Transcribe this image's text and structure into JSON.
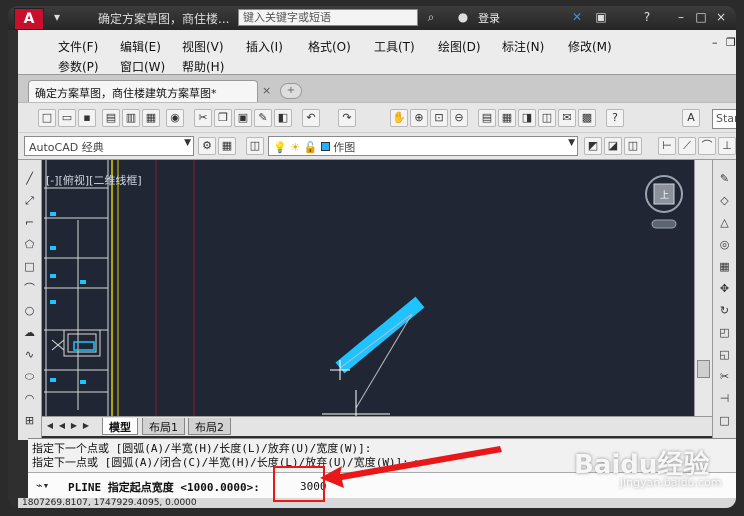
{
  "titlebar": {
    "logo": "A",
    "title": "确定方案草图，商住楼...",
    "search_placeholder": "键入关键字或短语",
    "login": "登录",
    "help": "?",
    "window_controls": [
      "–",
      "□",
      "×"
    ]
  },
  "menu": {
    "row1": [
      "文件(F)",
      "编辑(E)",
      "视图(V)",
      "插入(I)",
      "格式(O)",
      "工具(T)",
      "绘图(D)",
      "标注(N)",
      "修改(M)"
    ],
    "row2": [
      "参数(P)",
      "窗口(W)",
      "帮助(H)"
    ]
  },
  "document_tab": {
    "label": "确定方案草图，商住楼建筑方案草图*",
    "close": "×"
  },
  "toolbar": {
    "workspace": "AutoCAD 经典",
    "layer": "作图",
    "text_style": "Stand"
  },
  "viewport": {
    "label": "[-][俯视][二维线框]"
  },
  "layout_tabs": [
    "模型",
    "布局1",
    "布局2"
  ],
  "command": {
    "history": [
      "指定下一个点或 [圆弧(A)/半宽(H)/长度(L)/放弃(U)/宽度(W)]:",
      "指定下一点或 [圆弧(A)/闭合(C)/半宽(H)/长度(L)/放弃(U)/宽度(W)]: w"
    ],
    "prompt": "PLINE 指定起点宽度 <1000.0000>:",
    "input_value": "3000"
  },
  "status_bar": {
    "coords": "1807269.8107, 1747929.4095, 0.0000"
  },
  "watermark": {
    "brand": "Baidu经验",
    "url": "jingyan.baidu.com"
  },
  "colors": {
    "canvas": "#202633",
    "polyline": "#1ec3ff",
    "highlight": "#e81818"
  }
}
